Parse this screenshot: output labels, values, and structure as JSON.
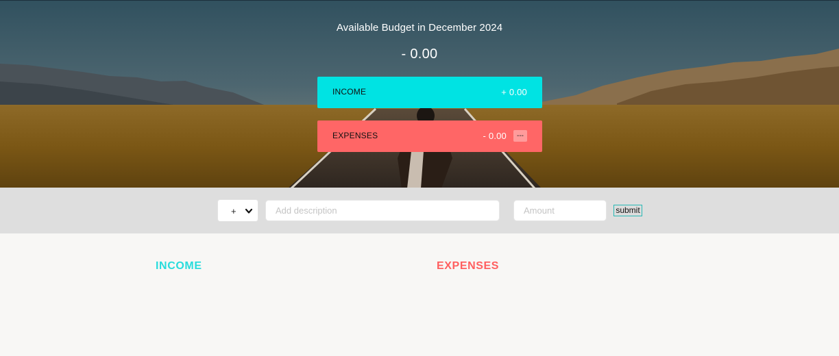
{
  "colors": {
    "income_accent": "#00e3e3",
    "expenses_accent": "#ff6666",
    "add_bar_background": "#dedede",
    "page_background": "#f8f7f5"
  },
  "budget": {
    "title_prefix": "Available Budget in",
    "month": "December 2024",
    "title": "Available Budget in December 2024",
    "value": "- 0.00",
    "income": {
      "label": "INCOME",
      "value": "+ 0.00"
    },
    "expenses": {
      "label": "EXPENSES",
      "value": "- 0.00",
      "percentage": "---"
    }
  },
  "add": {
    "type_options": [
      "+",
      "-"
    ],
    "type_selected": "+",
    "description_placeholder": "Add description",
    "description_value": "",
    "value_placeholder": "Amount",
    "value_value": "",
    "button_label": "submit",
    "caret_icon": "chevron-down-icon"
  },
  "lists": {
    "income_title": "Income",
    "expenses_title": "Expenses",
    "income_items": [],
    "expenses_items": []
  }
}
